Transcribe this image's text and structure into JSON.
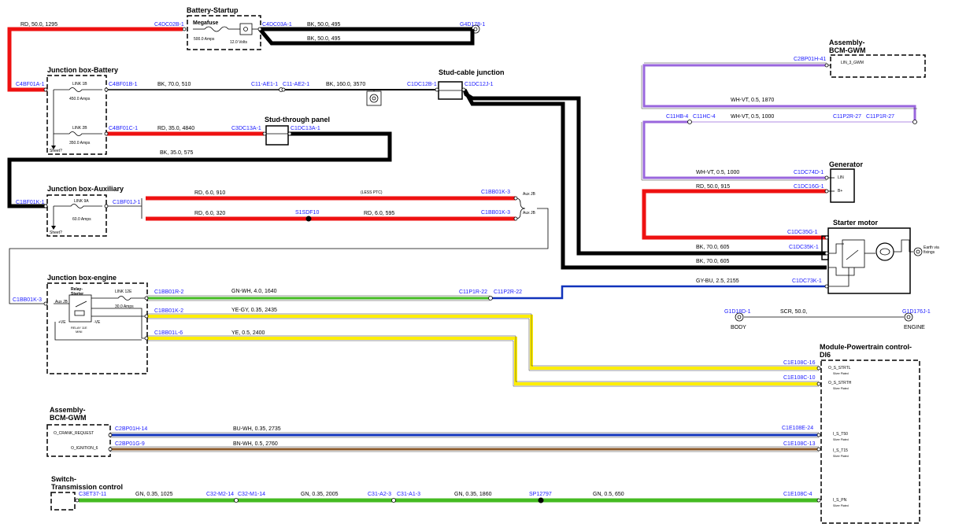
{
  "titles": {
    "battery_startup": "Battery-Startup",
    "jb_battery": "Junction box-Battery",
    "stud_cable": "Stud-cable junction",
    "stud_through": "Stud-through panel",
    "jb_aux": "Junction box-Auxiliary",
    "jb_engine": "Junction box-engine",
    "bcm_top_1": "Assembly-",
    "bcm_top_2": "BCM-GWM",
    "generator": "Generator",
    "starter_motor": "Starter motor",
    "pcm_1": "Module-Powertrain control-",
    "pcm_2": "DI6",
    "bcm_bot_1": "Assembly-",
    "bcm_bot_2": "BCM-GWM",
    "trans_1": "Switch-",
    "trans_2": "Transmission control"
  },
  "components": {
    "megafuse": "Megafuse",
    "megafuse_rating": "500.0 Amps",
    "battery_voltage": "12.0 Volts",
    "link1b": "LINK 1B",
    "link1b_rating": "450.0 Amps",
    "link2b": "LINK 2B",
    "link2b_rating": "350.0 Amps",
    "sheet1": "Sheet?",
    "link9a": "LINK 9A",
    "link9a_rating": "60.0 Amps",
    "sheet2": "Sheet?",
    "link12e": "LINK 12E",
    "link12e_rating": "30.0 Amps",
    "relay_1": "Relay-",
    "relay_2": "Starter",
    "relay_sub_1": "RELAY 11E",
    "relay_sub_2": "MINI",
    "pve": "+VE",
    "nve": "-VE",
    "aux_jb_left": "Aux JB",
    "aux_jb_r1": "Aux JB",
    "aux_jb_r2": "Aux JB",
    "lin_gwm": "LIN_3_GWM",
    "gen_lin": "LIN",
    "gen_bplus": "B+",
    "earth_1": "Earth via",
    "earth_2": "fixings",
    "body": "BODY",
    "engine": "ENGINE",
    "o_s_strtl": "O_S_STRTL",
    "o_s_strth": "O_S_STRTH",
    "i_s_t50": "I_S_T50",
    "i_s_t15": "I_S_T15",
    "i_s_pn": "I_S_PN",
    "silver": "Silver Plated",
    "o_crank": "O_CRANK_REQUEST",
    "o_ign": "O_IGNITION_6"
  },
  "wires": {
    "w1": "RD, 50.0, 1295",
    "w2": "BK, 50.0, 495",
    "w3": "BK, 50.0, 495",
    "w4": "BK, 70.0, 510",
    "w5": "BK, 160.0, 3570",
    "w6": "RD, 35.0, 4840",
    "w7": "BK, 35.0, 575",
    "w8": "RD, 6.0, 910",
    "w8_note": "(LESS PTC)",
    "w9": "RD, 6.0, 320",
    "w10": "RD, 6.0, 595",
    "w11": "WH-VT, 0.5, 1870",
    "w12": "WH-VT, 0.5, 1000",
    "w13": "WH-VT, 0.5, 1000",
    "w14": "RD, 50.0, 915",
    "w15": "BK, 70.0, 605",
    "w16": "BK, 70.0, 605",
    "w17": "GY-BU, 2.5, 2155",
    "w18": "GN-WH, 4.0, 1640",
    "w19": "YE-GY, 0.35, 2435",
    "w20": "YE, 0.5, 2400",
    "w21": "SCR, 50.0,",
    "w22": "BU-WH, 0.35, 2735",
    "w23": "BN-WH, 0.5, 2760",
    "w24": "GN, 0.35, 1025",
    "w25": "GN, 0.35, 2005",
    "w26": "GN, 0.35, 1860",
    "w27": "GN, 0.5, 650"
  },
  "connectors": {
    "c4dc02b": "C4DC02B-1",
    "c4dc03a": "C4DC03A-1",
    "g4d178": "G4D178-1",
    "c4bf01a": "C4BF01A-1",
    "c4bf01b": "C4BF01B-1",
    "c11ae1": "C11-AE1-1",
    "c11ae2": "C11-AE2-1",
    "c1dc12b": "C1DC12B-1",
    "c1dc12j": "C1DC12J-1",
    "c4bf01c": "C4BF01C-1",
    "c3dc13a": "C3DC13A-1",
    "c1dc13a": "C1DC13A-1",
    "c1bf01k": "C1BF01K-1",
    "c1bf01j": "C1BF01J-1",
    "c1bb01k_a": "C1BB01K-3",
    "c1bb01k_b": "C1BB01K-3",
    "s1sdf10": "S1SDF10",
    "c2bp01h_41": "C2BP01H-41",
    "c11hb4": "C11HB-4",
    "c11hc4": "C11HC-4",
    "c11p2r27": "C11P2R-27",
    "c11p1r27": "C11P1R-27",
    "c1dc74d": "C1DC74D-1",
    "c1dc16g": "C1DC16G-1",
    "c1dc35g": "C1DC35G-1",
    "c1dc35k": "C1DC35K-1",
    "c1dc73k": "C1DC73K-1",
    "c1bb01k_left": "C1BB01K-3",
    "c1bb01r": "C1BB01R-2",
    "c11p1r22": "C11P1R-22",
    "c11p2r22": "C11P2R-22",
    "c1bb01k_2": "C1BB01K-2",
    "c1bb01l": "C1BB01L-6",
    "g1d18d": "G1D18D-1",
    "g1d176j": "G1D176J-1",
    "c1e108c16": "C1E108C-16",
    "c1e108c10": "C1E108C-10",
    "c2bp01h14": "C2BP01H-14",
    "c1e108e24": "C1E108E-24",
    "c2bp01g9": "C2BP01G-9",
    "c1e108c13": "C1E108C-13",
    "c3et37": "C3ET37-11",
    "c32m214": "C32-M2-14",
    "c32m114": "C32-M1-14",
    "c31a23": "C31-A2-3",
    "c31a13": "C31-A1-3",
    "sp12797": "SP12797",
    "c1e108c4": "C1E108C-4"
  },
  "colors": {
    "red": "#ee1111",
    "black": "#000000",
    "violet": "#9966dd",
    "green": "#44bb22",
    "yellow": "#ffee00",
    "blue": "#1133bb",
    "brown": "#8b5a2b",
    "connector_text": "#1a1aff"
  }
}
